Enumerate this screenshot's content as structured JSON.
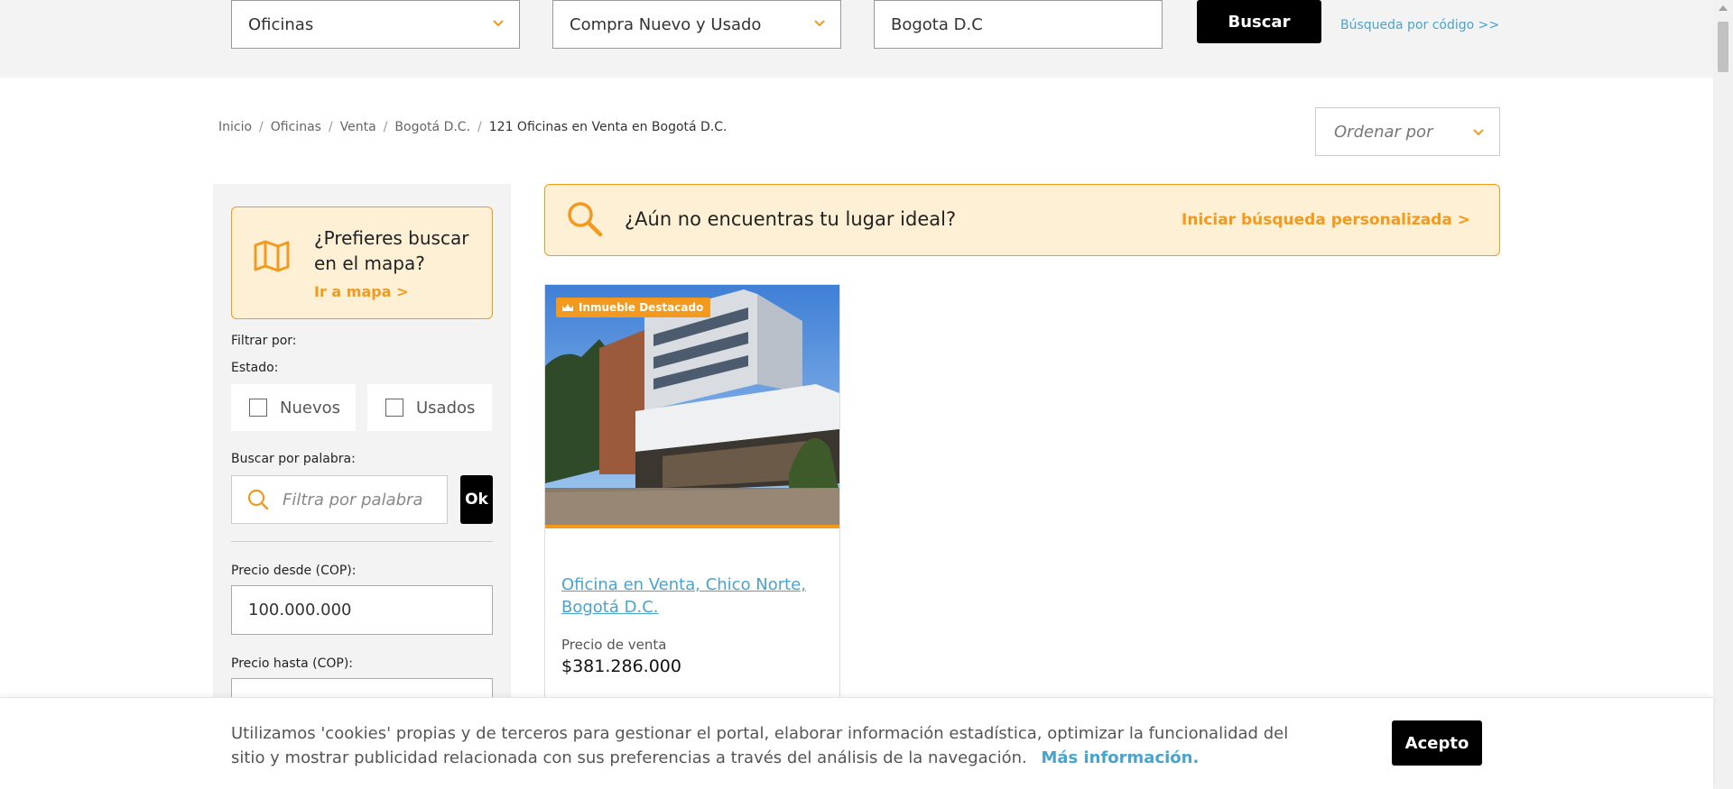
{
  "colors": {
    "accent": "#f39a1e",
    "link": "#4aa3cf",
    "banner_bg": "#fdf0d5",
    "button_bg": "#000000"
  },
  "search": {
    "property_type": "Oficinas",
    "operation": "Compra Nuevo y Usado",
    "location": "Bogota D.C",
    "button_label": "Buscar",
    "code_link": "Búsqueda por código >>"
  },
  "breadcrumb": {
    "items": [
      "Inicio",
      "Oficinas",
      "Venta",
      "Bogotá D.C."
    ],
    "separator": "/",
    "current": "121 Oficinas en Venta en Bogotá D.C."
  },
  "sort": {
    "placeholder": "Ordenar por"
  },
  "sidebar": {
    "map_prompt": "¿Prefieres buscar en el mapa?",
    "map_link": "Ir a mapa >",
    "filter_by": "Filtrar por:",
    "state_label": "Estado:",
    "state_options": [
      "Nuevos",
      "Usados"
    ],
    "keyword_label": "Buscar por palabra:",
    "keyword_placeholder": "Filtra por palabra",
    "ok_label": "Ok",
    "price_from_label": "Precio desde (COP):",
    "price_from_value": "100.000.000",
    "price_to_label": "Precio hasta (COP):",
    "price_to_value": ""
  },
  "banner": {
    "text": "¿Aún no encuentras tu lugar ideal?",
    "link": "Iniciar búsqueda personalizada >"
  },
  "listing": {
    "badge": "Inmueble Destacado",
    "title": "Oficina en Venta, Chico Norte, Bogotá D.C.",
    "price_label": "Precio de venta",
    "price": "$381.286.000"
  },
  "cookie": {
    "message": "Utilizamos 'cookies' propias y de terceros para gestionar el portal, elaborar información estadística, optimizar la funcionalidad del sitio y mostrar publicidad relacionada con sus preferencias a través del análisis de la navegación.",
    "more_link": "Más información.",
    "accept_label": "Acepto"
  }
}
